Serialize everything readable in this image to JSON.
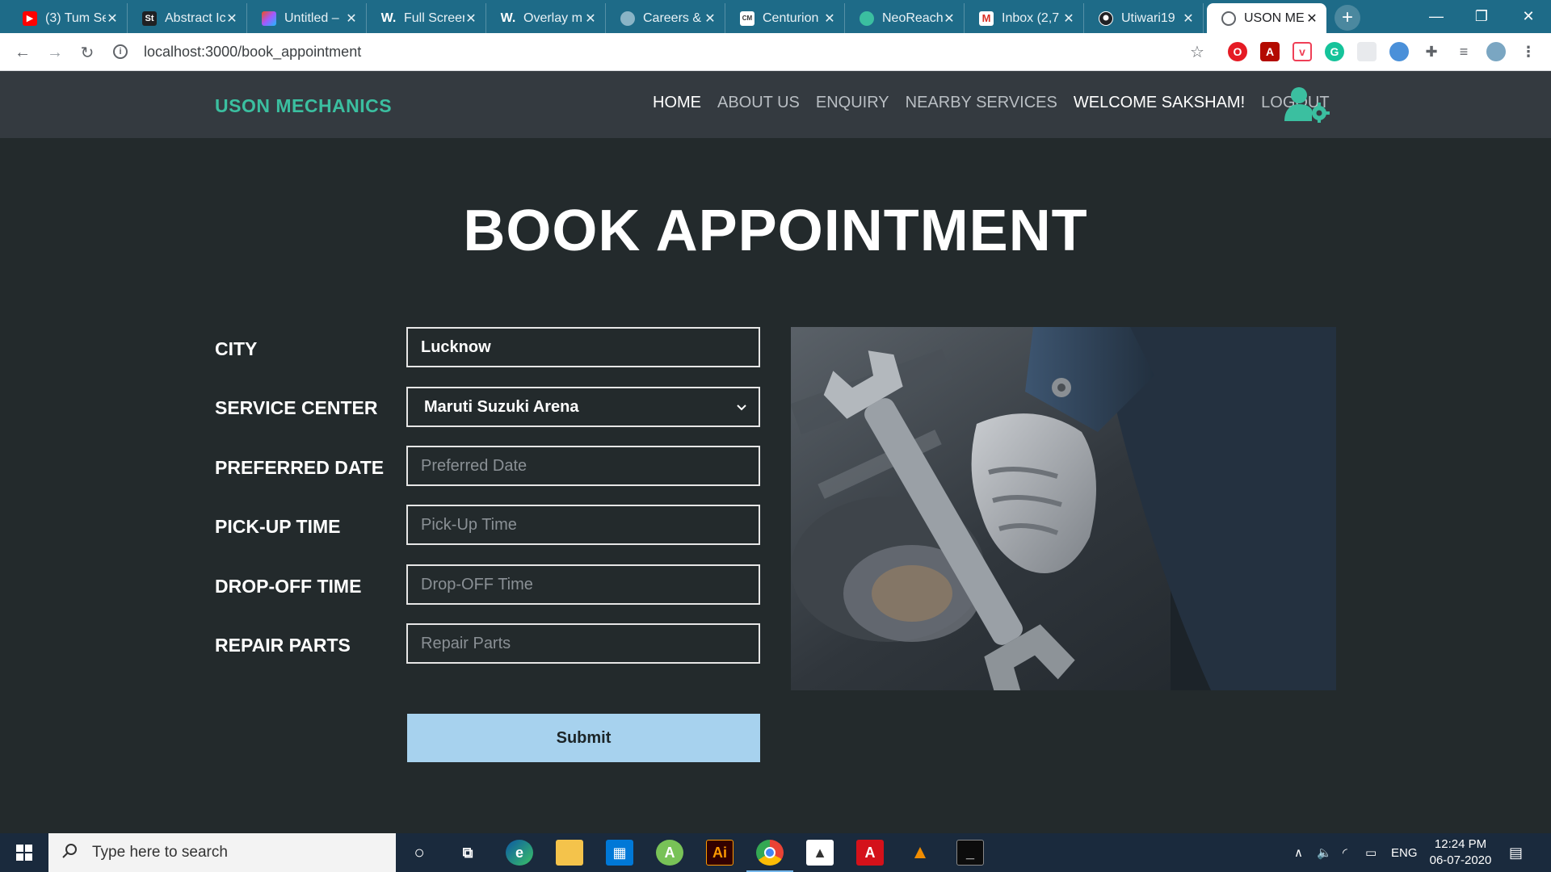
{
  "browser": {
    "tabs": [
      {
        "title": "(3) Tum Se",
        "icon": "youtube-icon",
        "color": "#ff0000"
      },
      {
        "title": "Abstract Ic",
        "icon": "stock-icon",
        "color": "#202124"
      },
      {
        "title": "Untitled –",
        "icon": "figma-icon",
        "color": "#a259ff"
      },
      {
        "title": "Full Screen",
        "icon": "w-icon",
        "color": "#202124"
      },
      {
        "title": "Overlay m",
        "icon": "w-icon",
        "color": "#202124"
      },
      {
        "title": "Careers &",
        "icon": "globe-icon",
        "color": "#8ab4c6"
      },
      {
        "title": "Centurion",
        "icon": "cm-icon",
        "color": "#ffffff"
      },
      {
        "title": "NeoReach",
        "icon": "neoreach-icon",
        "color": "#3bbfa0"
      },
      {
        "title": "Inbox (2,7",
        "icon": "gmail-icon",
        "color": "#d93025"
      },
      {
        "title": "Utiwari19",
        "icon": "github-icon",
        "color": "#202124"
      },
      {
        "title": "USON ME",
        "icon": "globe-icon",
        "color": "#5f6368"
      }
    ],
    "url": "localhost:3000/book_appointment"
  },
  "site": {
    "brand": "USON MECHANICS",
    "nav": {
      "home": "HOME",
      "about": "ABOUT US",
      "enquiry": "ENQUIRY",
      "nearby": "NEARBY SERVICES",
      "welcome": "WELCOME SAKSHAM!",
      "logout": "LOGOUT"
    },
    "accent": "#3bbfa0"
  },
  "page": {
    "title": "BOOK APPOINTMENT",
    "form": {
      "city_label": "CITY",
      "city_value": "Lucknow",
      "service_label": "SERVICE CENTER",
      "service_value": "Maruti Suzuki Arena",
      "date_label": "PREFERRED DATE",
      "date_placeholder": "Preferred Date",
      "pickup_label": "PICK-UP TIME",
      "pickup_placeholder": "Pick-Up Time",
      "dropoff_label": "DROP-OFF TIME",
      "dropoff_placeholder": "Drop-OFF Time",
      "parts_label": "REPAIR PARTS",
      "parts_placeholder": "Repair Parts",
      "submit_label": "Submit"
    },
    "submit_color": "#a7d2ee"
  },
  "taskbar": {
    "search_placeholder": "Type here to search",
    "lang": "ENG",
    "time": "12:24 PM",
    "date": "06-07-2020"
  }
}
